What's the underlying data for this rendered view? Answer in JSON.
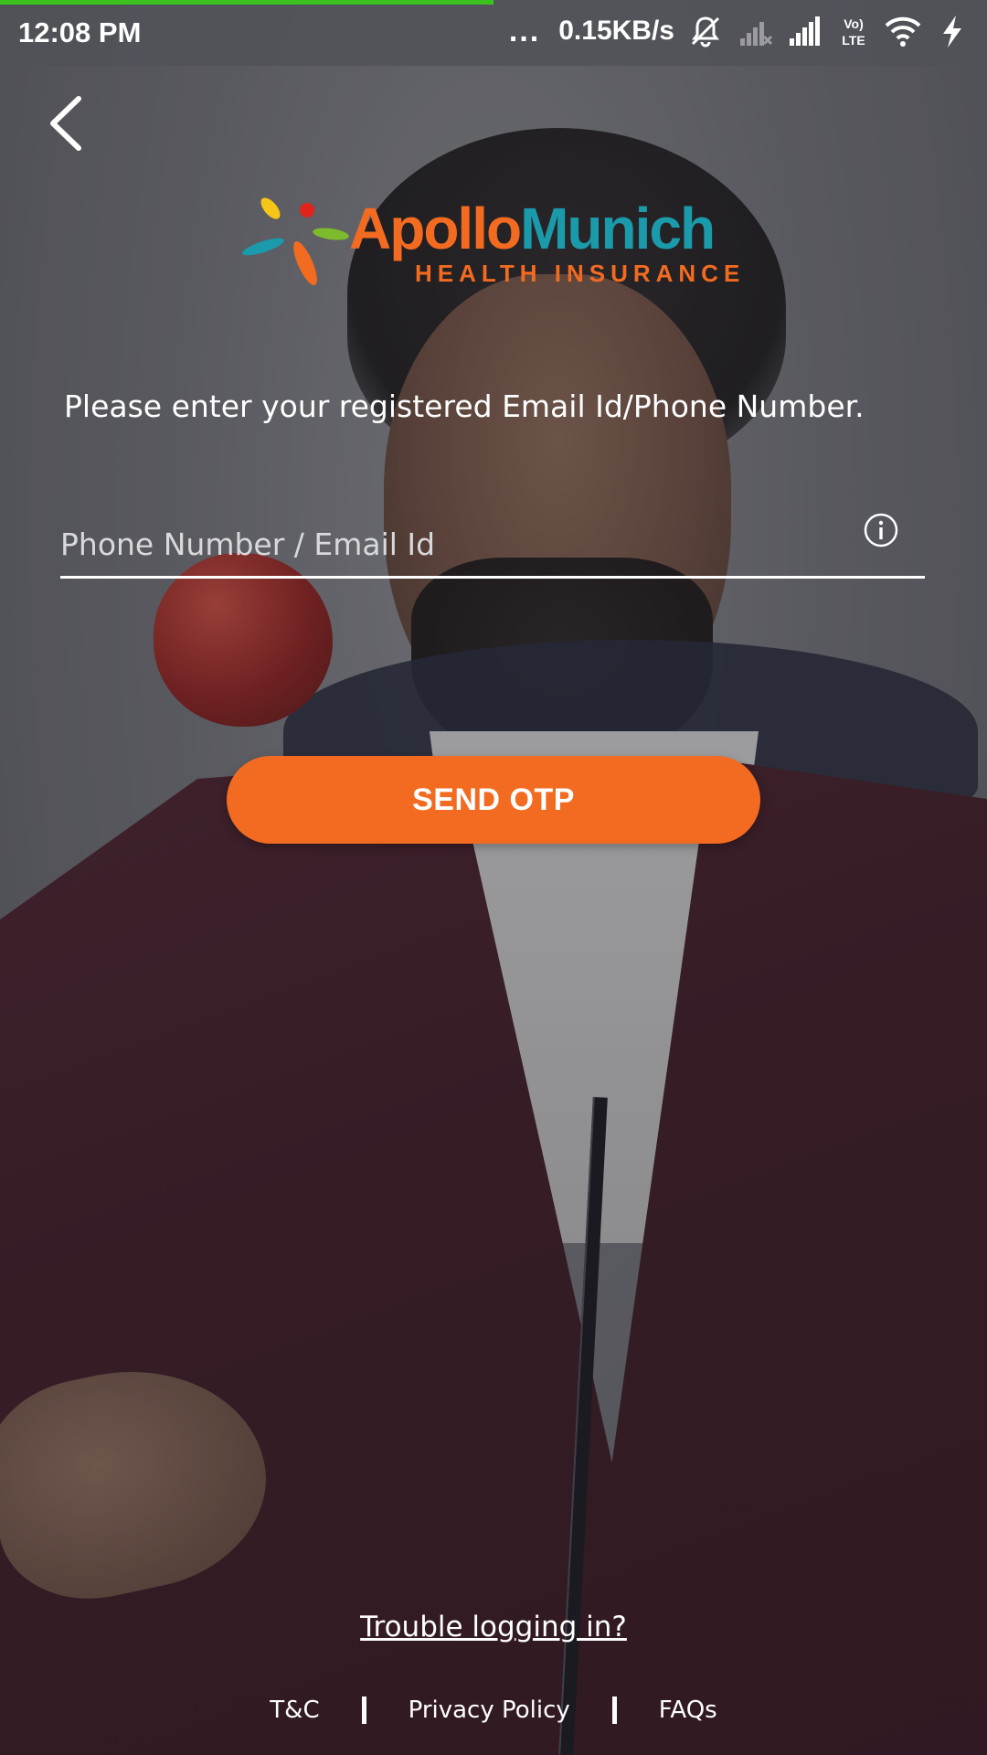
{
  "status_bar": {
    "time": "12:08 PM",
    "dots": "...",
    "speed": "0.15KB/s",
    "icons": [
      "mute-bell-icon",
      "signal-empty-icon",
      "signal-full-icon",
      "volte-icon",
      "wifi-icon",
      "charging-icon"
    ],
    "volte_top": "Vo)",
    "volte_bottom": "LTE",
    "load_progress_percent": 50
  },
  "header": {
    "back_icon": "chevron-left-icon"
  },
  "logo": {
    "word_apollo": "Apollo",
    "word_munich": "Munich",
    "subtitle": "HEALTH INSURANCE",
    "colors": {
      "orange": "#f26b21",
      "teal": "#1a9aaa",
      "yellow": "#f5c518",
      "red": "#e2231a",
      "green": "#7dbb2d",
      "blue": "#1a9aaa"
    }
  },
  "form": {
    "prompt": "Please enter your registered Email Id/Phone Number.",
    "input_placeholder": "Phone Number / Email Id",
    "input_value": "",
    "info_icon": "info-circle-icon",
    "send_label": "SEND OTP"
  },
  "links": {
    "trouble": "Trouble logging in?",
    "footer": [
      "T&C",
      "Privacy Policy",
      "FAQs"
    ]
  },
  "colors": {
    "accent": "#f26b21",
    "progress": "#3cc21f"
  }
}
